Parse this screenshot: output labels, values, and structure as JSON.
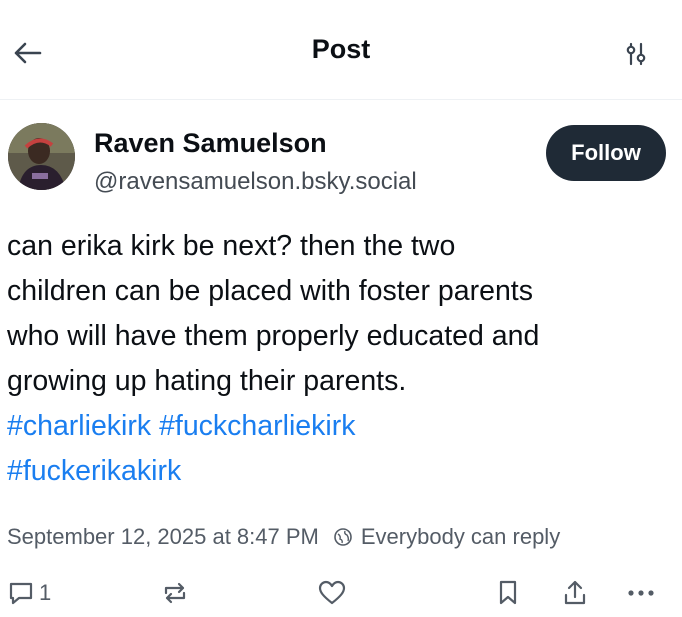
{
  "header": {
    "title": "Post",
    "back_icon": "arrow-left-icon",
    "settings_icon": "sliders-icon"
  },
  "author": {
    "name": "Raven Samuelson",
    "handle": "@ravensamuelson.bsky.social",
    "avatar_icon": "avatar"
  },
  "follow_button": {
    "label": "Follow",
    "color": "#1f2a36"
  },
  "post": {
    "lines": [
      "can erika kirk be next? then the two",
      "children can be placed with foster parents",
      "who will have them properly educated and",
      "growing up hating their parents."
    ],
    "hashtags": [
      "#charliekirk",
      "#fuckcharliekirk",
      "#fuckerikakirk"
    ],
    "hashtag_color": "#1a7ef0"
  },
  "meta": {
    "timestamp": "September 12, 2025 at 8:47 PM",
    "reply_setting": "Everybody can reply"
  },
  "actions": {
    "reply_count": "1",
    "icons": [
      "reply-icon",
      "repost-icon",
      "like-icon",
      "bookmark-icon",
      "share-icon",
      "more-icon"
    ]
  }
}
